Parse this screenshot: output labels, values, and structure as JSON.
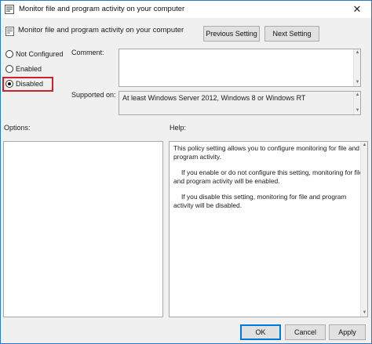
{
  "window": {
    "title": "Monitor file and program activity on your computer",
    "close_glyph": "✕"
  },
  "header": {
    "policy_name": "Monitor file and program activity on your computer",
    "previous_label": "Previous Setting",
    "next_label": "Next Setting"
  },
  "state": {
    "options": [
      {
        "label": "Not Configured",
        "checked": false
      },
      {
        "label": "Enabled",
        "checked": false
      },
      {
        "label": "Disabled",
        "checked": true
      }
    ]
  },
  "comment": {
    "label": "Comment:",
    "value": ""
  },
  "supported_on": {
    "label": "Supported on:",
    "value": "At least Windows Server 2012, Windows 8 or Windows RT"
  },
  "options_panel": {
    "label": "Options:"
  },
  "help_panel": {
    "label": "Help:",
    "paragraphs": [
      "This policy setting allows you to configure monitoring for file and program activity.",
      "If you enable or do not configure this setting, monitoring for file and program activity will be enabled.",
      "If you disable this setting, monitoring for file and program activity will be disabled."
    ]
  },
  "footer": {
    "ok_label": "OK",
    "cancel_label": "Cancel",
    "apply_label": "Apply"
  },
  "colors": {
    "highlight_border": "#d0202a",
    "window_border": "#2b7bc4",
    "dialog_background": "#f0f0f0"
  },
  "icons": {
    "app": "group-policy-icon",
    "policy": "policy-setting-icon",
    "close": "close-icon"
  }
}
